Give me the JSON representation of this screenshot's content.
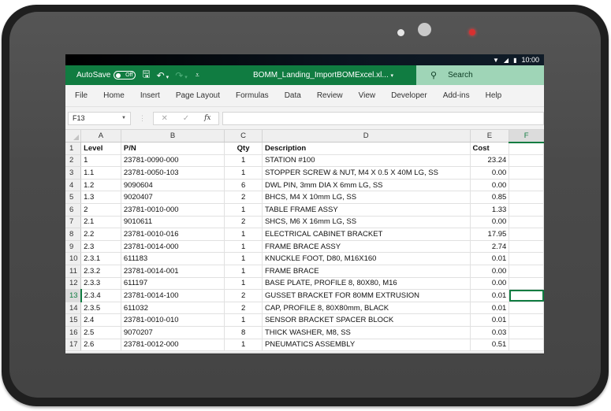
{
  "device": {
    "status_bar": {
      "time": "10:00",
      "icons": [
        "wifi-icon",
        "signal-icon",
        "battery-icon"
      ]
    }
  },
  "titlebar": {
    "autosave_label": "AutoSave",
    "autosave_state": "Off",
    "file_name": "BOMM_Landing_ImportBOMExcel.xl...",
    "search_label": "Search",
    "brand_color": "#107c41",
    "search_bg": "#9fd5b7"
  },
  "menu": {
    "items": [
      "File",
      "Home",
      "Insert",
      "Page Layout",
      "Formulas",
      "Data",
      "Review",
      "View",
      "Developer",
      "Add-ins",
      "Help"
    ]
  },
  "formula_bar": {
    "name_box": "F13",
    "cancel_glyph": "✕",
    "enter_glyph": "✓",
    "fx_label": "fx",
    "formula_value": ""
  },
  "sheet": {
    "column_headers": [
      "A",
      "B",
      "C",
      "D",
      "E",
      "F"
    ],
    "selected_column": "F",
    "selected_row": 13,
    "active_cell": "F13",
    "rows": [
      {
        "n": "1",
        "level": "Level",
        "pn": "P/N",
        "qty": "Qty",
        "desc": "Description",
        "cost": "Cost",
        "header": true
      },
      {
        "n": "2",
        "level": "1",
        "pn": "23781-0090-000",
        "qty": "1",
        "desc": "STATION #100",
        "cost": "23.24"
      },
      {
        "n": "3",
        "level": "1.1",
        "pn": "23781-0050-103",
        "qty": "1",
        "desc": "STOPPER SCREW & NUT, M4 X 0.5 X 40M LG, SS",
        "cost": "0.00"
      },
      {
        "n": "4",
        "level": "1.2",
        "pn": "9090604",
        "qty": "6",
        "desc": "DWL PIN, 3mm DIA X 6mm LG, SS",
        "cost": "0.00"
      },
      {
        "n": "5",
        "level": "1.3",
        "pn": "9020407",
        "qty": "2",
        "desc": "BHCS, M4 X 10mm LG, SS",
        "cost": "0.85"
      },
      {
        "n": "6",
        "level": "2",
        "pn": "23781-0010-000",
        "qty": "1",
        "desc": "TABLE FRAME ASSY",
        "cost": "1.33"
      },
      {
        "n": "7",
        "level": "2.1",
        "pn": "9010611",
        "qty": "2",
        "desc": "SHCS, M6 X 16mm LG, SS",
        "cost": "0.00"
      },
      {
        "n": "8",
        "level": "2.2",
        "pn": "23781-0010-016",
        "qty": "1",
        "desc": "ELECTRICAL CABINET BRACKET",
        "cost": "17.95"
      },
      {
        "n": "9",
        "level": "2.3",
        "pn": "23781-0014-000",
        "qty": "1",
        "desc": "FRAME BRACE ASSY",
        "cost": "2.74"
      },
      {
        "n": "10",
        "level": "2.3.1",
        "pn": "611183",
        "qty": "1",
        "desc": "KNUCKLE FOOT, D80, M16X160",
        "cost": "0.01"
      },
      {
        "n": "11",
        "level": "2.3.2",
        "pn": "23781-0014-001",
        "qty": "1",
        "desc": "FRAME BRACE",
        "cost": "0.00"
      },
      {
        "n": "12",
        "level": "2.3.3",
        "pn": "611197",
        "qty": "1",
        "desc": "BASE PLATE, PROFILE 8, 80X80, M16",
        "cost": "0.00"
      },
      {
        "n": "13",
        "level": "2.3.4",
        "pn": "23781-0014-100",
        "qty": "2",
        "desc": "GUSSET BRACKET FOR 80MM EXTRUSION",
        "cost": "0.01"
      },
      {
        "n": "14",
        "level": "2.3.5",
        "pn": "611032",
        "qty": "2",
        "desc": "CAP, PROFILE 8, 80X80mm, BLACK",
        "cost": "0.01"
      },
      {
        "n": "15",
        "level": "2.4",
        "pn": "23781-0010-010",
        "qty": "1",
        "desc": "SENSOR BRACKET SPACER BLOCK",
        "cost": "0.01"
      },
      {
        "n": "16",
        "level": "2.5",
        "pn": "9070207",
        "qty": "8",
        "desc": "THICK WASHER, M8, SS",
        "cost": "0.03"
      },
      {
        "n": "17",
        "level": "2.6",
        "pn": "23781-0012-000",
        "qty": "1",
        "desc": "PNEUMATICS ASSEMBLY",
        "cost": "0.51"
      }
    ]
  }
}
